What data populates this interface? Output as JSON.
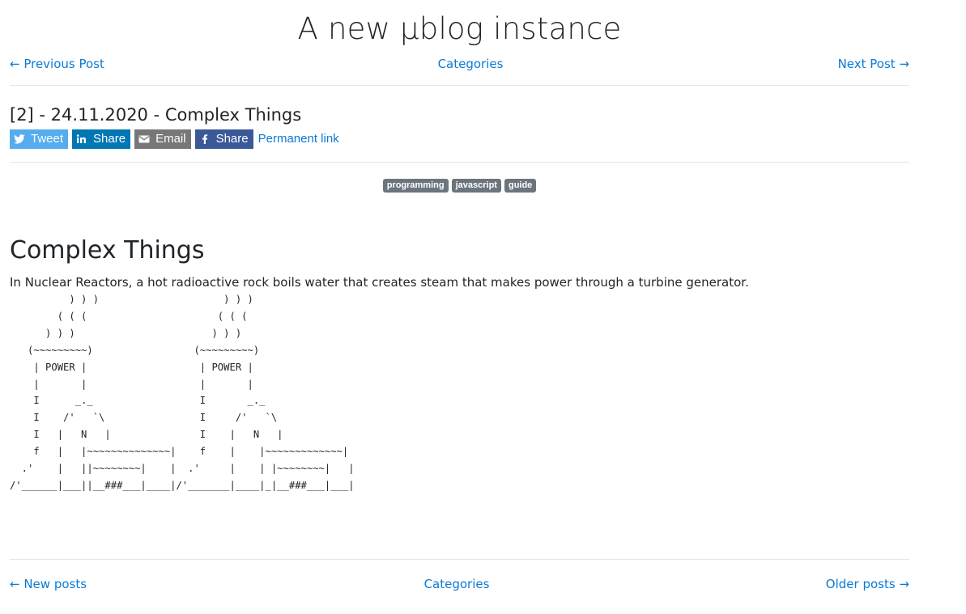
{
  "site": {
    "title": "A new µblog instance"
  },
  "top_nav": {
    "previous": "← Previous Post",
    "categories": "Categories",
    "next": "Next Post →"
  },
  "post": {
    "header": "[2] - 24.11.2020 - Complex Things",
    "share": {
      "tweet": "Tweet",
      "linkedin": "Share",
      "email": "Email",
      "facebook": "Share",
      "permalink": "Permanent link"
    },
    "tags": [
      "programming",
      "javascript",
      "guide"
    ],
    "title": "Complex Things",
    "intro": "In Nuclear Reactors, a hot radioactive rock boils water that creates steam that makes power through a turbine generator.",
    "ascii_art": "          ) ) )                     ) ) )\n        ( ( (                      ( ( (\n      ) ) )                       ) ) )\n   (~~~~~~~~~)                 (~~~~~~~~~)\n    | POWER |                   | POWER |\n    |       |                   |       |\n    I      _._                  I       _._\n    I    /'   `\\                I     /'   `\\\n    I   |   N   |               I    |   N   |\n    f   |   |~~~~~~~~~~~~~~|    f    |    |~~~~~~~~~~~~~|\n  .'    |   ||~~~~~~~~|    |  .'     |    | |~~~~~~~~|   |\n/'______|___||__###___|____|/'_______|____|_|__###___|___|"
  },
  "bottom_nav": {
    "newer": "← New posts",
    "categories": "Categories",
    "older": "Older posts →"
  },
  "colors": {
    "link": "#0a7bd6",
    "tweet": "#55acee",
    "linkedin": "#0077b5",
    "email": "#777777",
    "facebook": "#3b5998",
    "tag": "#6c757d"
  }
}
